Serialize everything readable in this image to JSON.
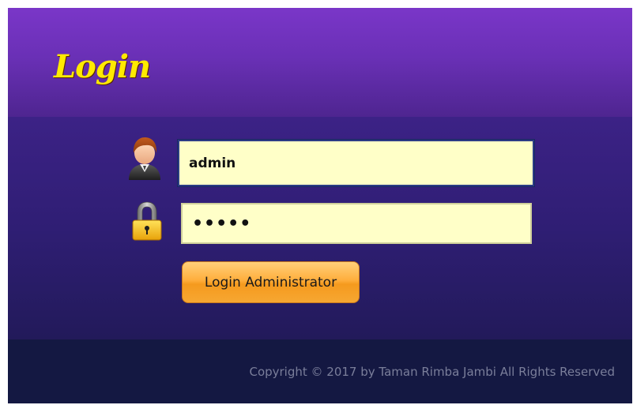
{
  "header": {
    "title": "Login"
  },
  "form": {
    "username_value": "admin",
    "password_value": "•••••",
    "submit_label": "Login Administrator"
  },
  "footer": {
    "copyright": "Copyright © 2017 by Taman Rimba Jambi All Rights Reserved"
  },
  "icons": {
    "user": "user-avatar-icon",
    "password": "padlock-icon"
  },
  "colors": {
    "title": "#ffea00",
    "header_top": "#7a36c8",
    "panel": "#2f1e74",
    "footer": "#141842",
    "input_bg": "#ffffc8",
    "button": "#ffae3c"
  }
}
